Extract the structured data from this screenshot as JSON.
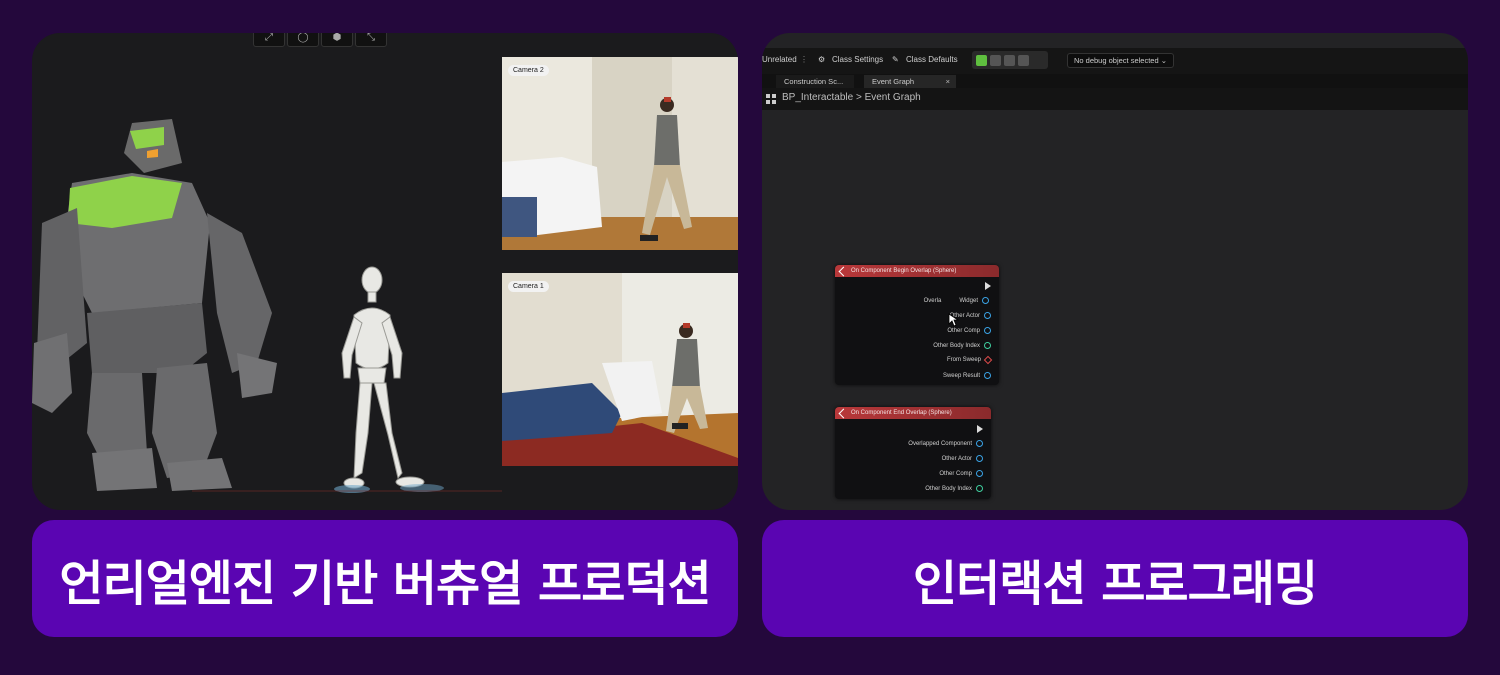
{
  "left_panel": {
    "cameras": [
      {
        "label": "Camera 2"
      },
      {
        "label": "Camera 1"
      }
    ],
    "toolbar_icons": [
      "transform-icon",
      "circle-icon",
      "cube-icon",
      "scale-icon"
    ]
  },
  "right_panel": {
    "toolbar": {
      "unrelated": "Unrelated",
      "class_settings": "Class Settings",
      "class_defaults": "Class Defaults",
      "debug_select": "No debug object selected"
    },
    "tabs": [
      {
        "label": "Construction Sc..."
      },
      {
        "label": "Event Graph",
        "close": "×"
      }
    ],
    "breadcrumb": {
      "blueprint": "BP_Interactable",
      "separator": ">",
      "graph": "Event Graph"
    },
    "nodes": [
      {
        "title": "On Component Begin Overlap (Sphere)",
        "pins": [
          "Overla",
          "Widget",
          "Other Actor",
          "Other Comp",
          "Other Body Index",
          "From Sweep",
          "Sweep Result"
        ]
      },
      {
        "title": "On Component End Overlap (Sphere)",
        "pins": [
          "Overlapped Component",
          "Other Actor",
          "Other Comp",
          "Other Body Index"
        ]
      }
    ]
  },
  "captions": {
    "left": "언리얼엔진 기반 버츄얼 프로덕션",
    "right": "인터랙션 프로그래밍"
  },
  "colors": {
    "background": "#24083c",
    "caption": "#5a05b2",
    "node_header": "#b9383a",
    "golem_accent": "#8fd24a"
  }
}
